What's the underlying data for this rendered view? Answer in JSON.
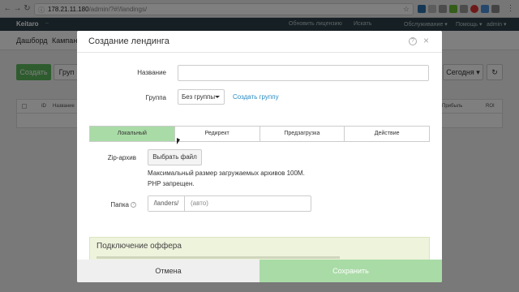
{
  "browser": {
    "url_host": "178.21.11.180",
    "url_path": "/admin/?#!/landings/"
  },
  "app": {
    "logo": "Keitaro",
    "logo_sub": "–",
    "top_links": [
      "Обновить лицензию",
      "Искать",
      "Обслуживание ▾",
      "Помощь ▾",
      "admin ▾"
    ],
    "menu": [
      "Дашборд",
      "Кампан"
    ],
    "create_button": "Создать",
    "group_button": "Груп",
    "date_button": "Сегодня ▾",
    "table_headers": [
      "ID",
      "Название",
      "Прибыль",
      "ROI"
    ]
  },
  "modal": {
    "title": "Создание лендинга",
    "help": "?",
    "close": "×",
    "name_label": "Название",
    "name_value": "",
    "group_label": "Группа",
    "group_value": "Без группы",
    "add_group_link": "Создать группу",
    "tabs": [
      {
        "label": "Локальный",
        "active": true
      },
      {
        "label": "Редирект",
        "active": false
      },
      {
        "label": "Предзагрузка",
        "active": false
      },
      {
        "label": "Действие",
        "active": false
      }
    ],
    "zip_label": "Zip-архив",
    "file_button": "Выбрать файл",
    "note_line1": "Максимальный размер загружаемых архивов 100M.",
    "note_line2": "PHP запрещен.",
    "folder_label": "Папка",
    "folder_prefix": "/landers/",
    "folder_placeholder": "(авто)",
    "offer_title": "Подключение оффера",
    "cancel": "Отмена",
    "save": "Сохранить"
  },
  "colors": {
    "accent_green": "#a9dba6",
    "primary_green": "#5cb85c",
    "link_blue": "#2a8bc4",
    "topbar": "#2d3e48"
  }
}
